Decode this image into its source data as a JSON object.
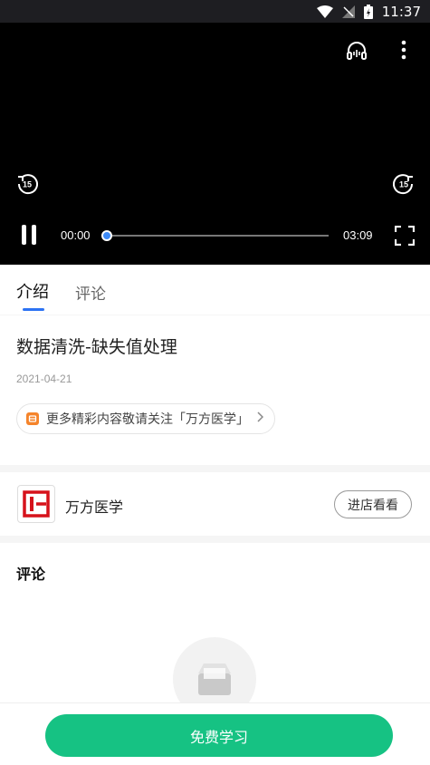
{
  "status_bar": {
    "time": "11:37"
  },
  "player": {
    "current_time": "00:00",
    "duration": "03:09",
    "progress": 0
  },
  "tabs": [
    {
      "label": "介绍",
      "active": true
    },
    {
      "label": "评论",
      "active": false
    }
  ],
  "lesson": {
    "title": "数据清洗-缺失值处理",
    "date": "2021-04-21",
    "follow_text": "更多精彩内容敬请关注「万方医学」"
  },
  "shop": {
    "name": "万方医学",
    "button_label": "进店看看"
  },
  "comments": {
    "title": "评论"
  },
  "cta": {
    "label": "免费学习"
  },
  "colors": {
    "accent_blue": "#2d73f3",
    "cta_green": "#16c283",
    "logo_red": "#d6121b"
  }
}
